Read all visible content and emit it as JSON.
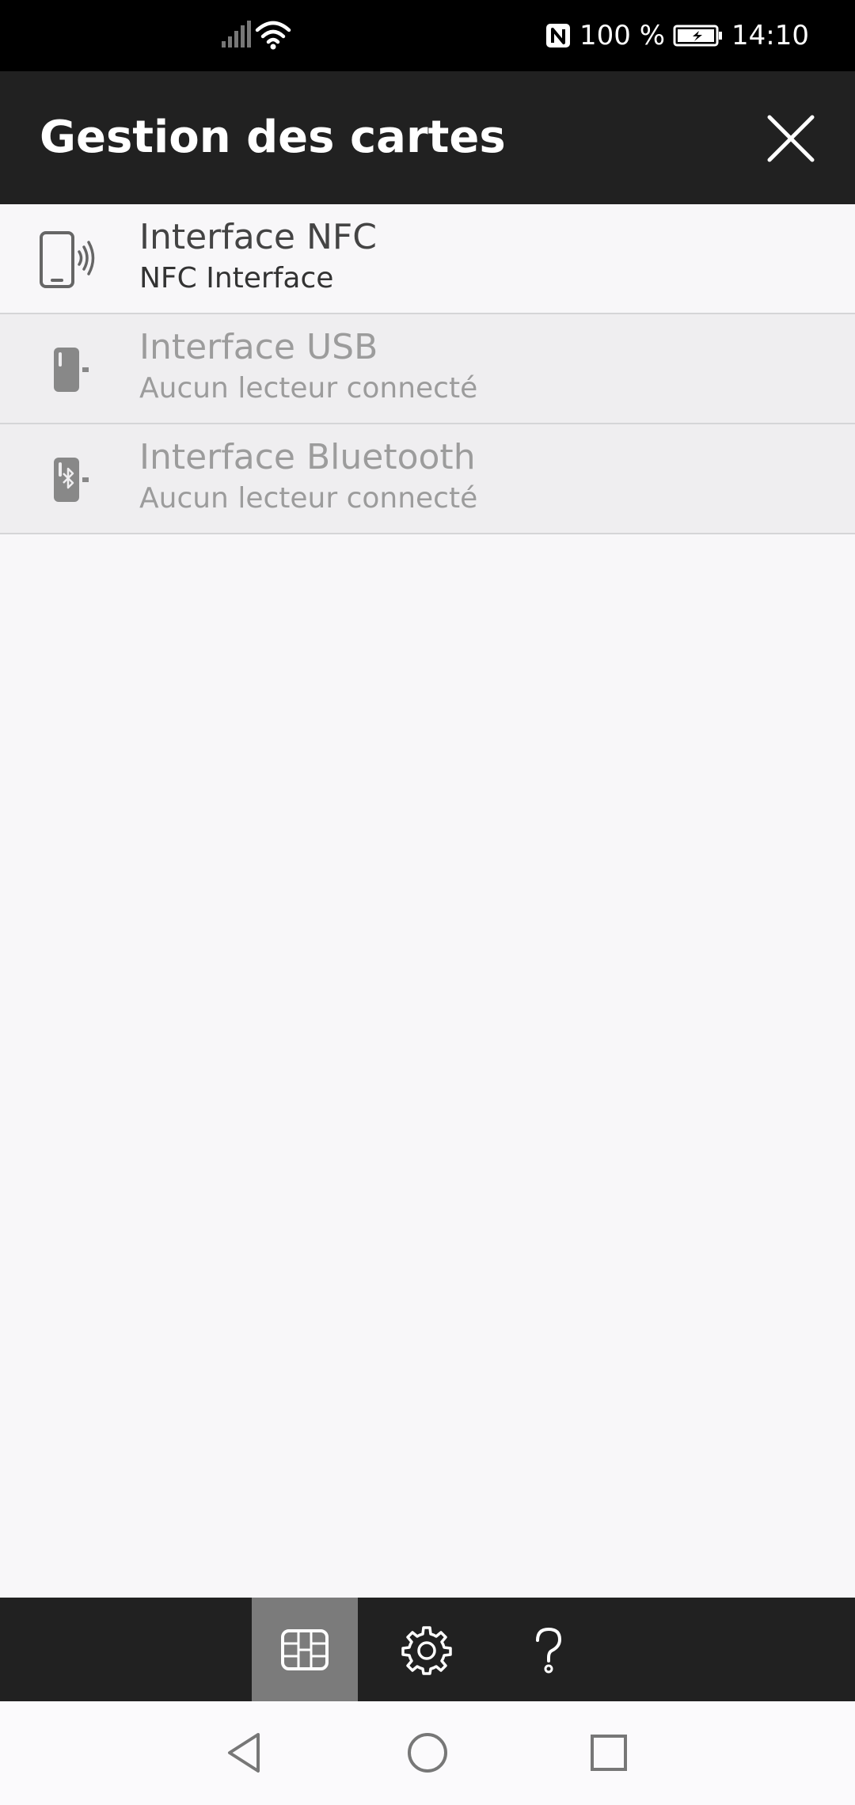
{
  "status_bar": {
    "battery": "100 %",
    "time": "14:10"
  },
  "app_bar": {
    "title": "Gestion des cartes"
  },
  "list": {
    "items": [
      {
        "title": "Interface NFC",
        "subtitle": "NFC Interface",
        "icon": "nfc-phone-icon",
        "enabled": true
      },
      {
        "title": "Interface USB",
        "subtitle": "Aucun lecteur connecté",
        "icon": "usb-reader-icon",
        "enabled": false
      },
      {
        "title": "Interface Bluetooth",
        "subtitle": "Aucun lecteur connecté",
        "icon": "bluetooth-reader-icon",
        "enabled": false
      }
    ]
  },
  "bottom_nav": {
    "tabs": [
      {
        "icon": "card-icon",
        "active": true
      },
      {
        "icon": "gear-icon",
        "active": false
      },
      {
        "icon": "question-icon",
        "active": false
      }
    ]
  },
  "colors": {
    "app_bar": "#212121",
    "active_tab": "#7b7b7b",
    "background": "#f8f7f9",
    "disabled_text": "#9c9c9c"
  }
}
